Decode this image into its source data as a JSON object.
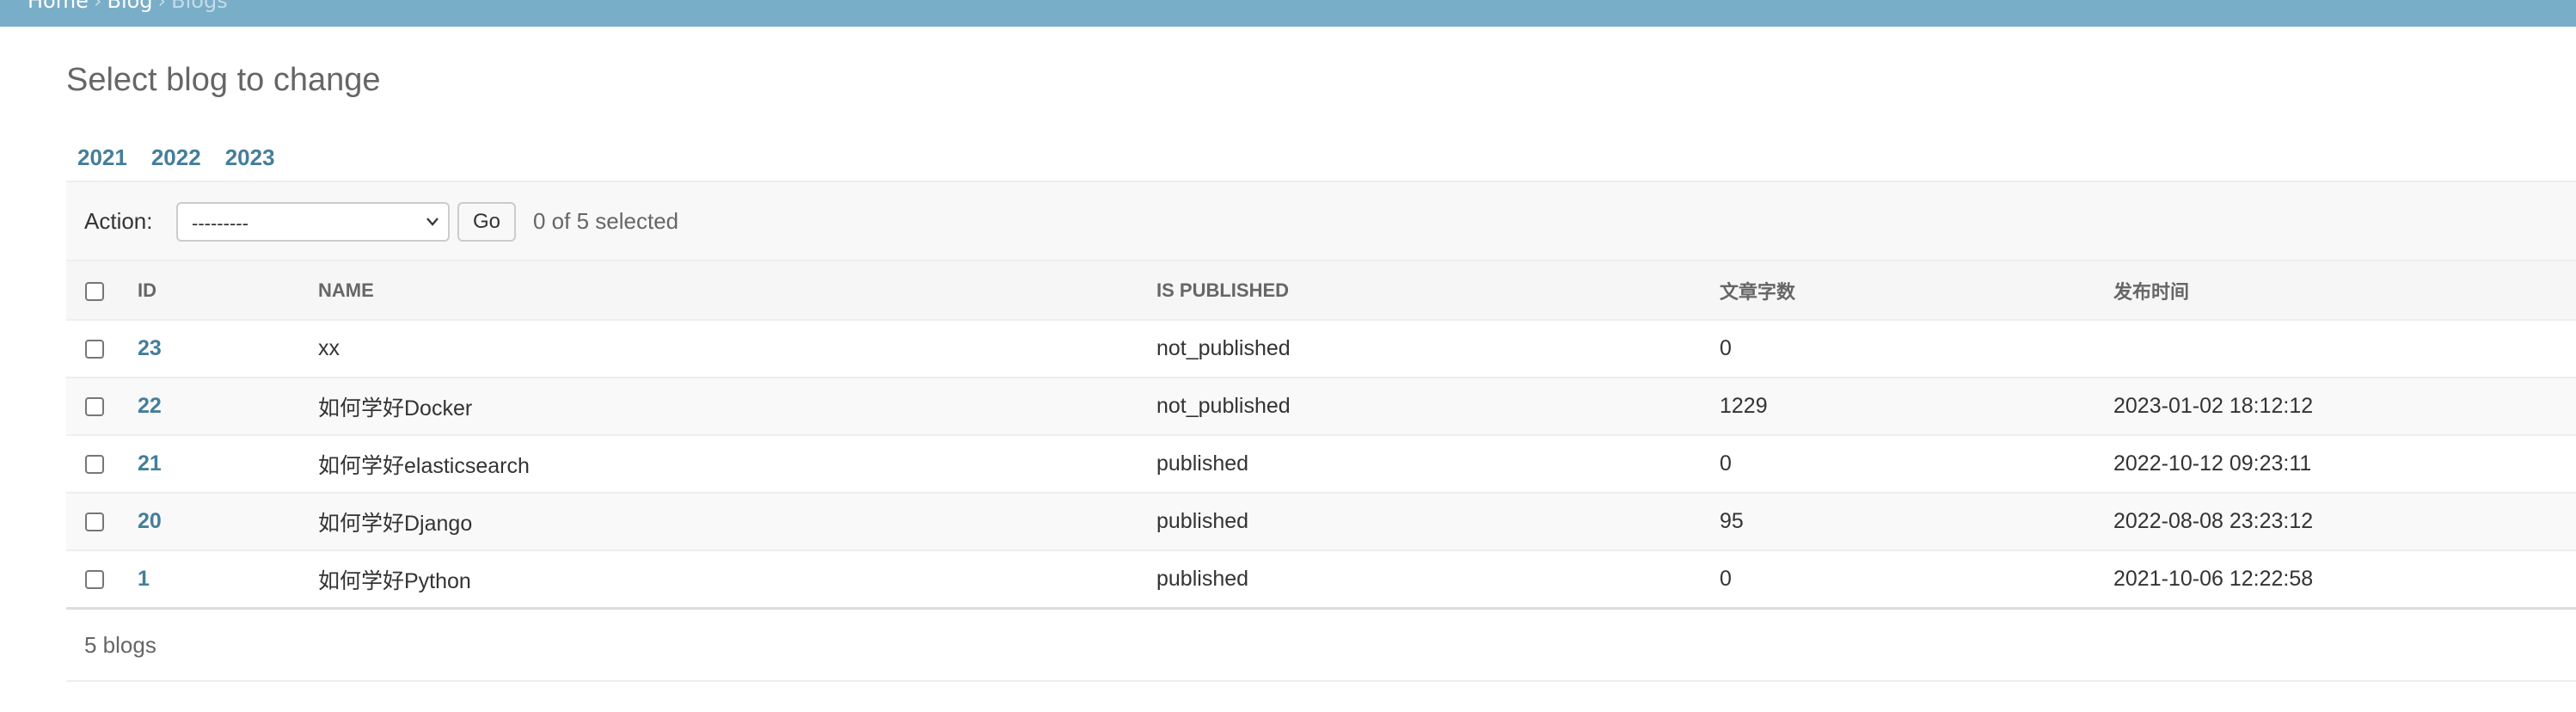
{
  "breadcrumbs": {
    "home": "Home",
    "app": "Blog",
    "current": "Blogs",
    "separator": "›"
  },
  "page_title": "Select blog to change",
  "date_hierarchy": [
    "2021",
    "2022",
    "2023"
  ],
  "actions": {
    "label": "Action:",
    "selected_option": "---------",
    "go_label": "Go",
    "selection_count": "0 of 5 selected"
  },
  "table": {
    "columns": [
      "ID",
      "NAME",
      "IS PUBLISHED",
      "文章字数",
      "发布时间"
    ],
    "rows": [
      {
        "id": "23",
        "name": "xx",
        "status": "not_published",
        "word_count": "0",
        "publish_time": ""
      },
      {
        "id": "22",
        "name": "如何学好Docker",
        "status": "not_published",
        "word_count": "1229",
        "publish_time": "2023-01-02 18:12:12"
      },
      {
        "id": "21",
        "name": "如何学好elasticsearch",
        "status": "published",
        "word_count": "0",
        "publish_time": "2022-10-12 09:23:11"
      },
      {
        "id": "20",
        "name": "如何学好Django",
        "status": "published",
        "word_count": "95",
        "publish_time": "2022-08-08 23:23:12"
      },
      {
        "id": "1",
        "name": "如何学好Python",
        "status": "published",
        "word_count": "0",
        "publish_time": "2021-10-06 12:22:58"
      }
    ]
  },
  "paginator": "5 blogs",
  "colors": {
    "header_bar": "#79aec8",
    "link": "#447e9b"
  }
}
